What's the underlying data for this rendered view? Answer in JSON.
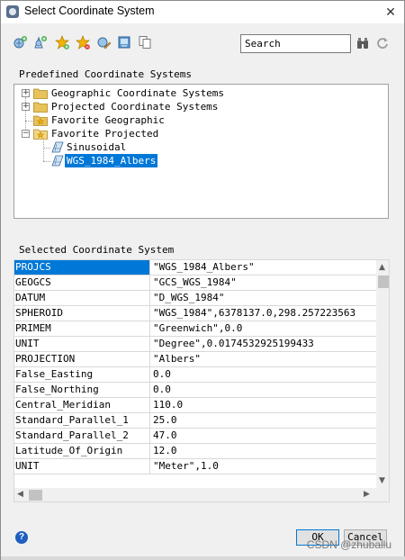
{
  "window": {
    "title": "Select Coordinate System",
    "close_glyph": "✕"
  },
  "toolbar": {
    "icons": [
      "new-geographic-icon",
      "new-projected-icon",
      "add-favorite-icon",
      "remove-favorite-icon",
      "edit-icon",
      "import-icon",
      "copy-icon"
    ],
    "search_value": "Search",
    "search_icon": "binoculars-icon",
    "refresh_icon": "refresh-icon"
  },
  "predefined": {
    "label": "Predefined Coordinate Systems",
    "tree": [
      {
        "label": "Geographic Coordinate Systems",
        "expander": "+"
      },
      {
        "label": "Projected Coordinate Systems",
        "expander": "+"
      },
      {
        "label": "Favorite Geographic",
        "expander": ""
      },
      {
        "label": "Favorite Projected",
        "expander": "−"
      },
      {
        "label": "Sinusoidal"
      },
      {
        "label": "WGS_1984_Albers",
        "selected": true
      }
    ]
  },
  "selected": {
    "label": "Selected Coordinate System",
    "rows": [
      {
        "key": "PROJCS",
        "value": "\"WGS_1984_Albers\""
      },
      {
        "key": "GEOGCS",
        "value": "\"GCS_WGS_1984\""
      },
      {
        "key": "DATUM",
        "value": "\"D_WGS_1984\""
      },
      {
        "key": "SPHEROID",
        "value": "\"WGS_1984\",6378137.0,298.257223563"
      },
      {
        "key": "PRIMEM",
        "value": "\"Greenwich\",0.0"
      },
      {
        "key": "UNIT",
        "value": "\"Degree\",0.0174532925199433"
      },
      {
        "key": "PROJECTION",
        "value": "\"Albers\""
      },
      {
        "key": "False_Easting",
        "value": "0.0"
      },
      {
        "key": "False_Northing",
        "value": "0.0"
      },
      {
        "key": "Central_Meridian",
        "value": "110.0"
      },
      {
        "key": "Standard_Parallel_1",
        "value": "25.0"
      },
      {
        "key": "Standard_Parallel_2",
        "value": "47.0"
      },
      {
        "key": "Latitude_Of_Origin",
        "value": "12.0"
      },
      {
        "key": "UNIT",
        "value": "\"Meter\",1.0"
      }
    ]
  },
  "buttons": {
    "help": "?",
    "ok": "OK",
    "cancel": "Cancel"
  },
  "watermark": "CSDN @zhuballu",
  "colors": {
    "selection": "#0078d7",
    "favorite_star": "#f2b200",
    "folder": "#e8c25a"
  }
}
